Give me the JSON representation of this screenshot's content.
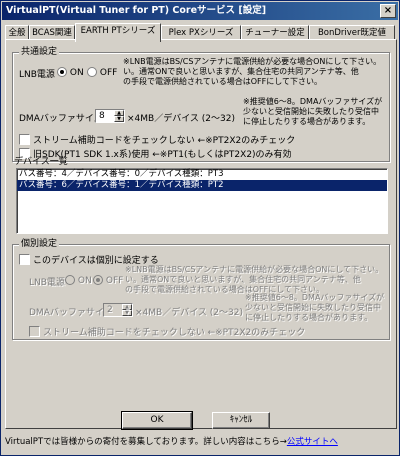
{
  "window": {
    "title": "VirtualPT(Virtual Tuner for PT) Coreサービス [設定]",
    "close_glyph": "×"
  },
  "tabs": [
    {
      "label": "全般"
    },
    {
      "label": "BCAS関連"
    },
    {
      "label": "EARTH PTシリーズ"
    },
    {
      "label": "Plex PXシリーズ"
    },
    {
      "label": "チューナー設定"
    },
    {
      "label": "BonDriver既定値"
    }
  ],
  "common": {
    "group_label": "共通設定",
    "lnb": {
      "label": "LNB電源",
      "on_label": "ON",
      "off_label": "OFF",
      "selected": "ON",
      "note": [
        "※LNB電源はBS/CSアンテナに電源供給が必要な場合ONにして下さい。",
        "い。通常ONで良いと思いますが、集合住宅の共同アンテナ等、他",
        "の手段で電源供給されている場合はOFFにして下さい。"
      ]
    },
    "dma": {
      "label": "DMAバッファサイズ",
      "value": "8",
      "suffix": "×4MB／デバイス (2～32)",
      "note": [
        "※推奨値6～8。DMAバッファサイズが",
        "少ないと受信開始に失敗したり受信中",
        "に停止したりする場合があります。"
      ]
    },
    "stream_check": {
      "label": "ストリーム補助コードをチェックしない ←※PT2X2のみチェック",
      "checked": false
    },
    "old_sdk": {
      "label": "旧SDK(PT1 SDK 1.x系)使用 ←※PT1(もしくはPT2X2)のみ有効",
      "checked": false
    }
  },
  "devices": {
    "label": "デバイス一覧",
    "items": [
      {
        "text": "バス番号：4／デバイス番号：0／デバイス種類：PT3",
        "selected": false
      },
      {
        "text": "バス番号：6／デバイス番号：1／デバイス種類：PT2",
        "selected": true
      }
    ]
  },
  "individual": {
    "group_label": "個別設定",
    "enable": {
      "label": "このデバイスは個別に設定する",
      "checked": false
    },
    "lnb": {
      "label": "LNB電源",
      "on_label": "ON",
      "off_label": "OFF",
      "selected": "OFF",
      "note": [
        "※LNB電源はBS/CSアンテナに電源供給が必要な場合ONにして下さい。",
        "い。通常ONで良いと思いますが、集合住宅の共同アンテナ等、他",
        "の手段で電源供給されている場合はOFFにして下さい。"
      ]
    },
    "dma": {
      "label": "DMAバッファサイズ",
      "value": "2",
      "suffix": "×4MB／デバイス (2～32)",
      "note": [
        "※推奨値6～8。DMAバッファサイズが",
        "少ないと受信開始に失敗したり受信中",
        "に停止したりする場合があります。"
      ]
    },
    "stream_check": {
      "label": "ストリーム補助コードをチェックしない ←※PT2X2のみチェック",
      "checked": false
    }
  },
  "buttons": {
    "ok": "OK",
    "cancel": "ｷｬﾝｾﾙ"
  },
  "footer": {
    "text": "VirtualPTでは皆様からの寄付を募集しております。詳しい内容はこちら→",
    "link": "公式サイトへ"
  }
}
